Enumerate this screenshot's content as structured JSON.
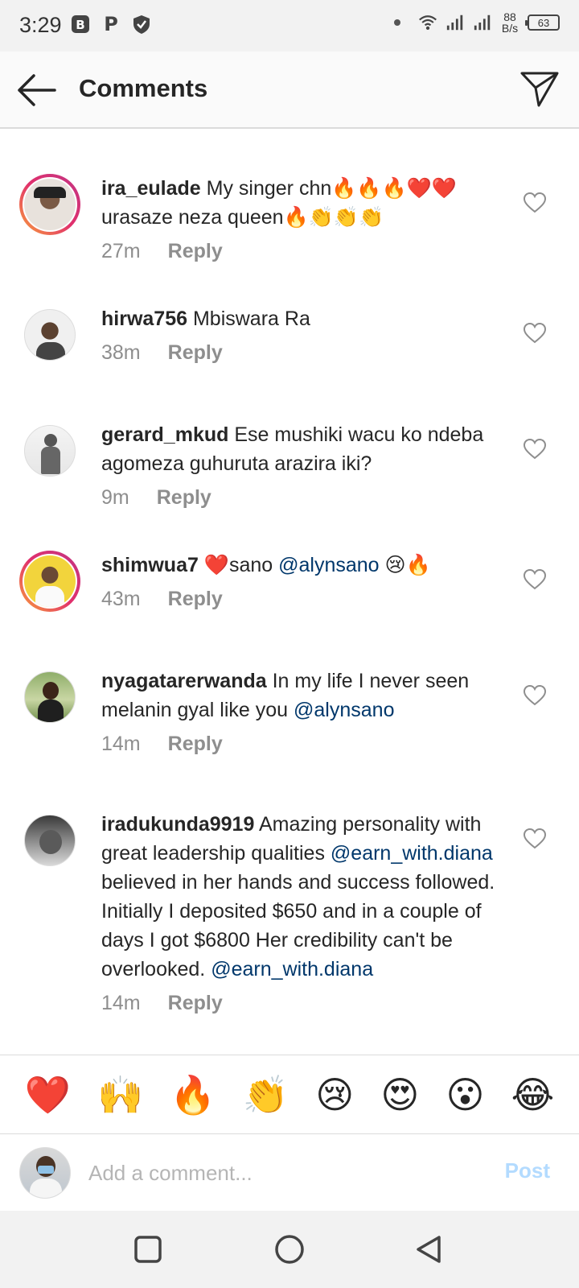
{
  "status_bar": {
    "time": "3:29",
    "net_speed_value": "88",
    "net_speed_unit": "B/s",
    "battery": "63"
  },
  "header": {
    "title": "Comments"
  },
  "comments": [
    {
      "username": "ira_eulade",
      "text": "My singer chn🔥🔥🔥❤️❤️ urasaze neza queen🔥👏👏👏",
      "mentions": [],
      "time": "27m",
      "reply_label": "Reply",
      "story_ring": true
    },
    {
      "username": "hirwa756",
      "text": "Mbiswara Ra",
      "mentions": [],
      "time": "38m",
      "reply_label": "Reply",
      "story_ring": false
    },
    {
      "username": "gerard_mkud",
      "text": "Ese mushiki wacu ko ndeba agomeza guhuruta arazira iki?",
      "mentions": [],
      "time": "9m",
      "reply_label": "Reply",
      "story_ring": false
    },
    {
      "username": "shimwua7",
      "text_before": "❤️sano ",
      "mention1": "@alynsano",
      "text_after": " 😢🔥",
      "time": "43m",
      "reply_label": "Reply",
      "story_ring": true
    },
    {
      "username": "nyagatarerwanda",
      "text_before": "In my life I never seen melanin gyal like you ",
      "mention1": "@alynsano",
      "time": "14m",
      "reply_label": "Reply",
      "story_ring": false
    },
    {
      "username": "iradukunda9919",
      "text_before": "Amazing personality with great leadership qualities ",
      "mention1": "@earn_with.diana",
      "text_middle": " believed in her hands and success followed.  Initially I deposited $650 and in a couple of days I got $6800 Her credibility can't be overlooked. ",
      "mention2": "@earn_with.diana",
      "time": "14m",
      "reply_label": "Reply",
      "story_ring": false
    }
  ],
  "emoji_bar": [
    "❤️",
    "🙌",
    "🔥",
    "👏",
    "😢",
    "😍",
    "😮",
    "😂"
  ],
  "input": {
    "placeholder": "Add a comment...",
    "value": "",
    "post_label": "Post"
  },
  "icons": {
    "accent_mention": "#00376b",
    "post_disabled": "#b3dbff"
  }
}
